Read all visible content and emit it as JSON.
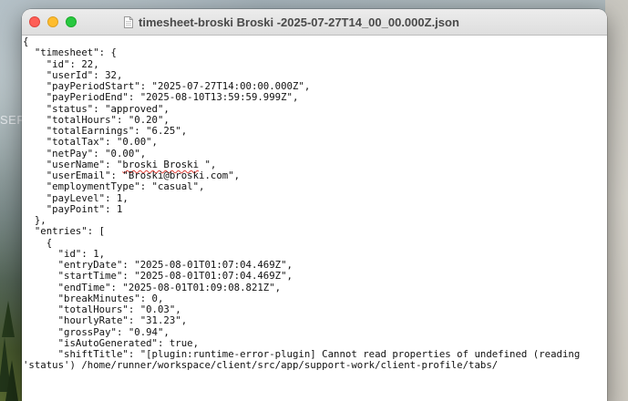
{
  "wallpaper": {
    "label": "SER"
  },
  "window": {
    "title": "timesheet-broski Broski -2025-07-27T14_00_00.000Z.json",
    "file_icon": "document-icon"
  },
  "json_lines": [
    {
      "text": "{"
    },
    {
      "text": "  \"timesheet\": {"
    },
    {
      "text": "    \"id\": 22,"
    },
    {
      "text": "    \"userId\": 32,"
    },
    {
      "text": "    \"payPeriodStart\": \"2025-07-27T14:00:00.000Z\","
    },
    {
      "text": "    \"payPeriodEnd\": \"2025-08-10T13:59:59.999Z\","
    },
    {
      "text": "    \"status\": \"approved\","
    },
    {
      "text": "    \"totalHours\": \"0.20\","
    },
    {
      "text": "    \"totalEarnings\": \"6.25\","
    },
    {
      "text": "    \"totalTax\": \"0.00\","
    },
    {
      "text": "    \"netPay\": \"0.00\","
    },
    {
      "pre": "    \"userName\": \"",
      "mark": "broski Broski",
      "post": " \","
    },
    {
      "text": "    \"userEmail\": \"Broski@broski.com\","
    },
    {
      "text": "    \"employmentType\": \"casual\","
    },
    {
      "text": "    \"payLevel\": 1,"
    },
    {
      "text": "    \"payPoint\": 1"
    },
    {
      "text": "  },"
    },
    {
      "text": "  \"entries\": ["
    },
    {
      "text": "    {"
    },
    {
      "text": "      \"id\": 1,"
    },
    {
      "text": "      \"entryDate\": \"2025-08-01T01:07:04.469Z\","
    },
    {
      "text": "      \"startTime\": \"2025-08-01T01:07:04.469Z\","
    },
    {
      "text": "      \"endTime\": \"2025-08-01T01:09:08.821Z\","
    },
    {
      "text": "      \"breakMinutes\": 0,"
    },
    {
      "text": "      \"totalHours\": \"0.03\","
    },
    {
      "text": "      \"hourlyRate\": \"31.23\","
    },
    {
      "text": "      \"grossPay\": \"0.94\","
    },
    {
      "text": "      \"isAutoGenerated\": true,"
    },
    {
      "text": "      \"shiftTitle\": \"[plugin:runtime-error-plugin] Cannot read properties of undefined (reading"
    },
    {
      "text": "'status') /home/runner/workspace/client/src/app/support-work/client-profile/tabs/"
    }
  ],
  "colors": {
    "close": "#fe5f57",
    "minimize": "#febc2e",
    "maximize": "#28c840",
    "spell_underline": "#e0413a"
  }
}
